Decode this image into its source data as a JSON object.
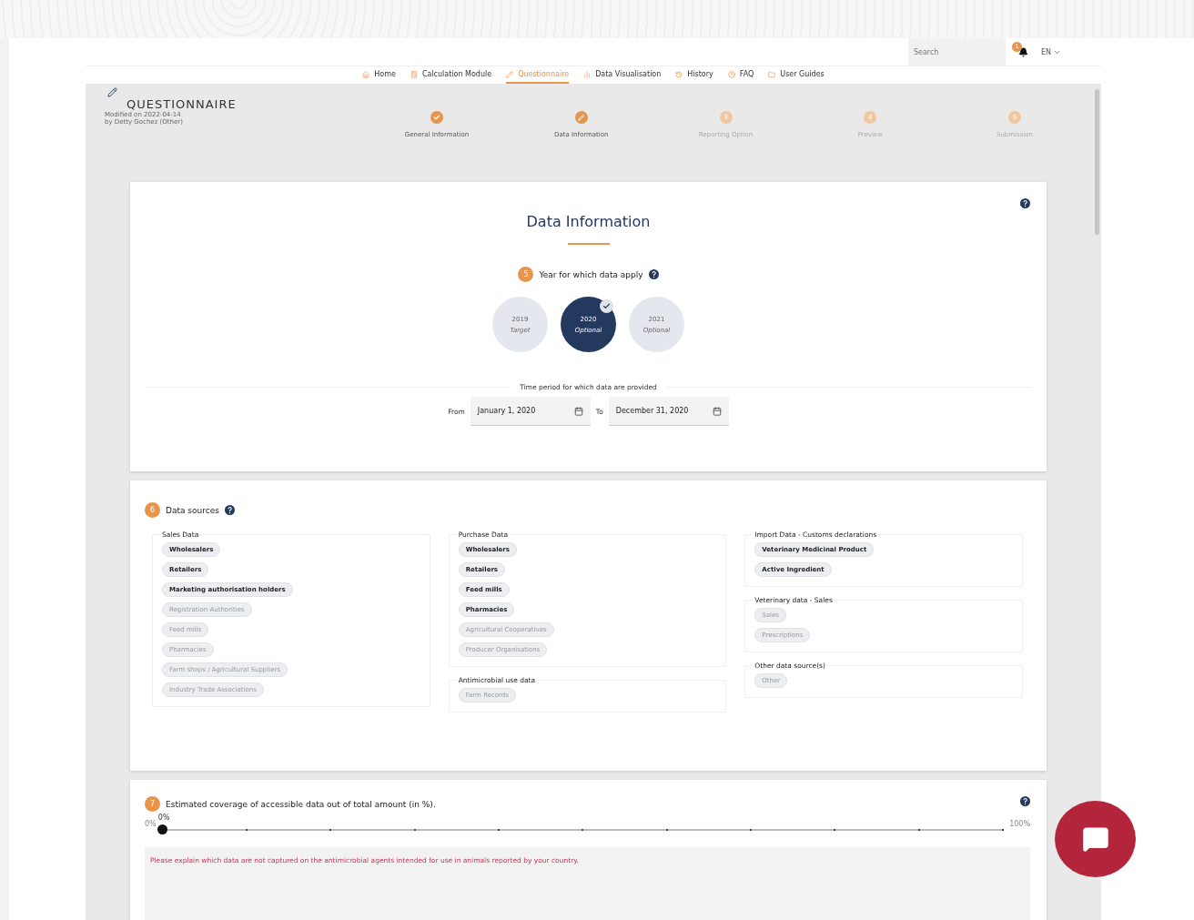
{
  "header": {
    "search": {
      "placeholder": "Search"
    },
    "notification_count": "1",
    "language": "EN"
  },
  "nav": [
    {
      "label": "Home",
      "selected": false
    },
    {
      "label": "Calculation Module",
      "selected": false
    },
    {
      "label": "Questionnaire",
      "selected": true
    },
    {
      "label": "Data Visualisation",
      "selected": false
    },
    {
      "label": "History",
      "selected": false
    },
    {
      "label": "FAQ",
      "selected": false
    },
    {
      "label": "User Guides",
      "selected": false
    }
  ],
  "questionnaire": {
    "title": "QUESTIONNAIRE",
    "modified": "Modified on 2022-04-14",
    "by": "by Detty Gochez (Other)"
  },
  "steps": [
    {
      "label": "General Information",
      "completed": true,
      "selected": false
    },
    {
      "label": "Data Information",
      "completed": true,
      "selected": true
    },
    {
      "label": "Reporting Option",
      "completed": false,
      "selected": false,
      "number": "3"
    },
    {
      "label": "Preview",
      "completed": false,
      "selected": false,
      "number": "4"
    },
    {
      "label": "Submission",
      "completed": false,
      "selected": false,
      "number": "5"
    }
  ],
  "data_information": {
    "title": "Data Information",
    "question_number": "5",
    "question": "Year for which data apply",
    "years": [
      {
        "year": "2019",
        "note": "Target",
        "selected": false
      },
      {
        "year": "2020",
        "note": "Optional",
        "selected": true
      },
      {
        "year": "2021",
        "note": "Optional",
        "selected": false
      }
    ],
    "period_label": "Time period for which data are provided",
    "from_label": "From",
    "from_value": "January 1, 2020",
    "to_label": "To",
    "to_value": "December 31, 2020"
  },
  "data_sources": {
    "question_number": "6",
    "question": "Data sources",
    "columns": [
      [
        {
          "title": "Sales Data",
          "chips": [
            {
              "label": "Wholesalers",
              "selected": true
            },
            {
              "label": "Retailers",
              "selected": true
            },
            {
              "label": "Marketing authorisation holders",
              "selected": true
            },
            {
              "label": "Registration Authorities",
              "selected": false
            },
            {
              "label": "Feed mills",
              "selected": false
            },
            {
              "label": "Pharmacies",
              "selected": false
            },
            {
              "label": "Farm shops / Agricultural Suppliers",
              "selected": false
            },
            {
              "label": "Industry Trade Associations",
              "selected": false
            }
          ]
        }
      ],
      [
        {
          "title": "Purchase Data",
          "chips": [
            {
              "label": "Wholesalers",
              "selected": true
            },
            {
              "label": "Retailers",
              "selected": true
            },
            {
              "label": "Feed mills",
              "selected": true
            },
            {
              "label": "Pharmacies",
              "selected": true
            },
            {
              "label": "Agricultural Cooperatives",
              "selected": false
            },
            {
              "label": "Producer Organisations",
              "selected": false
            }
          ]
        },
        {
          "title": "Antimicrobial use data",
          "chips": [
            {
              "label": "Farm Records",
              "selected": false
            }
          ]
        }
      ],
      [
        {
          "title": "Import Data - Customs declarations",
          "chips": [
            {
              "label": "Veterinary Medicinal Product",
              "selected": true
            },
            {
              "label": "Active Ingredient",
              "selected": true
            }
          ]
        },
        {
          "title": "Veterinary data - Sales",
          "chips": [
            {
              "label": "Sales",
              "selected": false
            },
            {
              "label": "Prescriptions",
              "selected": false
            }
          ]
        },
        {
          "title": "Other data source(s)",
          "chips": [
            {
              "label": "Other",
              "selected": false
            }
          ]
        }
      ]
    ]
  },
  "coverage": {
    "question_number": "7",
    "question": "Estimated coverage of accessible data out of total amount (in %).",
    "value_label": "0%",
    "min_label": "0%",
    "max_label": "100%",
    "level": 0,
    "explain": {
      "placeholder": "Please explain which data are not captured on the antimicrobial agents intended for use in animals reported by your country."
    }
  }
}
